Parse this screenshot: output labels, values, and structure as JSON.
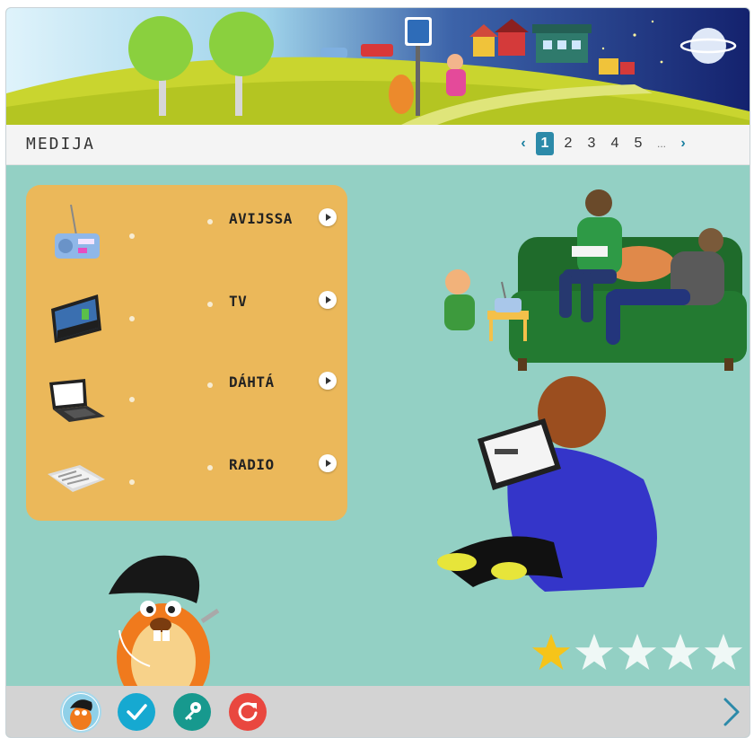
{
  "header": {
    "title": "MEDIJA",
    "sign_icon": "pedestrian-crossing-sign-icon"
  },
  "pagination": {
    "prev_label": "‹",
    "pages": [
      "1",
      "2",
      "3",
      "4",
      "5"
    ],
    "current": "1",
    "ellipsis": "...",
    "next_label": "›"
  },
  "media_list": {
    "items": [
      {
        "label": "AVIJSSA",
        "icon": "radio-icon"
      },
      {
        "label": "TV",
        "icon": "tv-icon"
      },
      {
        "label": "DÁHTÁ",
        "icon": "laptop-icon"
      },
      {
        "label": "RADIO",
        "icon": "newspaper-icon"
      }
    ]
  },
  "rating": {
    "filled": 1,
    "total": 5
  },
  "footer": {
    "buttons": [
      "mascot-avatar-button",
      "check-button",
      "key-button",
      "restart-button"
    ],
    "next_icon": "chevron-right-icon"
  },
  "colors": {
    "main_bg": "#93d0c4",
    "panel": "#ebb85a",
    "pager_active": "#2c8aa9",
    "check": "#16a9d1",
    "key": "#17998e",
    "restart": "#e9473f",
    "star_filled": "#f6c419"
  }
}
